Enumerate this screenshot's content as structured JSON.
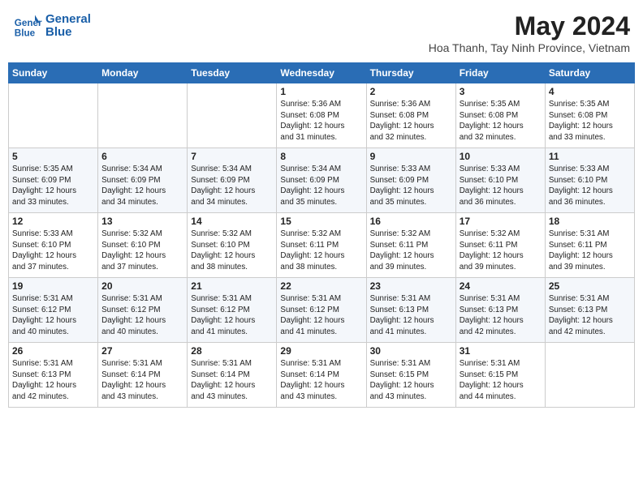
{
  "header": {
    "logo_line1": "General",
    "logo_line2": "Blue",
    "title": "May 2024",
    "subtitle": "Hoa Thanh, Tay Ninh Province, Vietnam"
  },
  "weekdays": [
    "Sunday",
    "Monday",
    "Tuesday",
    "Wednesday",
    "Thursday",
    "Friday",
    "Saturday"
  ],
  "weeks": [
    [
      {
        "day": "",
        "info": ""
      },
      {
        "day": "",
        "info": ""
      },
      {
        "day": "",
        "info": ""
      },
      {
        "day": "1",
        "info": "Sunrise: 5:36 AM\nSunset: 6:08 PM\nDaylight: 12 hours\nand 31 minutes."
      },
      {
        "day": "2",
        "info": "Sunrise: 5:36 AM\nSunset: 6:08 PM\nDaylight: 12 hours\nand 32 minutes."
      },
      {
        "day": "3",
        "info": "Sunrise: 5:35 AM\nSunset: 6:08 PM\nDaylight: 12 hours\nand 32 minutes."
      },
      {
        "day": "4",
        "info": "Sunrise: 5:35 AM\nSunset: 6:08 PM\nDaylight: 12 hours\nand 33 minutes."
      }
    ],
    [
      {
        "day": "5",
        "info": "Sunrise: 5:35 AM\nSunset: 6:09 PM\nDaylight: 12 hours\nand 33 minutes."
      },
      {
        "day": "6",
        "info": "Sunrise: 5:34 AM\nSunset: 6:09 PM\nDaylight: 12 hours\nand 34 minutes."
      },
      {
        "day": "7",
        "info": "Sunrise: 5:34 AM\nSunset: 6:09 PM\nDaylight: 12 hours\nand 34 minutes."
      },
      {
        "day": "8",
        "info": "Sunrise: 5:34 AM\nSunset: 6:09 PM\nDaylight: 12 hours\nand 35 minutes."
      },
      {
        "day": "9",
        "info": "Sunrise: 5:33 AM\nSunset: 6:09 PM\nDaylight: 12 hours\nand 35 minutes."
      },
      {
        "day": "10",
        "info": "Sunrise: 5:33 AM\nSunset: 6:10 PM\nDaylight: 12 hours\nand 36 minutes."
      },
      {
        "day": "11",
        "info": "Sunrise: 5:33 AM\nSunset: 6:10 PM\nDaylight: 12 hours\nand 36 minutes."
      }
    ],
    [
      {
        "day": "12",
        "info": "Sunrise: 5:33 AM\nSunset: 6:10 PM\nDaylight: 12 hours\nand 37 minutes."
      },
      {
        "day": "13",
        "info": "Sunrise: 5:32 AM\nSunset: 6:10 PM\nDaylight: 12 hours\nand 37 minutes."
      },
      {
        "day": "14",
        "info": "Sunrise: 5:32 AM\nSunset: 6:10 PM\nDaylight: 12 hours\nand 38 minutes."
      },
      {
        "day": "15",
        "info": "Sunrise: 5:32 AM\nSunset: 6:11 PM\nDaylight: 12 hours\nand 38 minutes."
      },
      {
        "day": "16",
        "info": "Sunrise: 5:32 AM\nSunset: 6:11 PM\nDaylight: 12 hours\nand 39 minutes."
      },
      {
        "day": "17",
        "info": "Sunrise: 5:32 AM\nSunset: 6:11 PM\nDaylight: 12 hours\nand 39 minutes."
      },
      {
        "day": "18",
        "info": "Sunrise: 5:31 AM\nSunset: 6:11 PM\nDaylight: 12 hours\nand 39 minutes."
      }
    ],
    [
      {
        "day": "19",
        "info": "Sunrise: 5:31 AM\nSunset: 6:12 PM\nDaylight: 12 hours\nand 40 minutes."
      },
      {
        "day": "20",
        "info": "Sunrise: 5:31 AM\nSunset: 6:12 PM\nDaylight: 12 hours\nand 40 minutes."
      },
      {
        "day": "21",
        "info": "Sunrise: 5:31 AM\nSunset: 6:12 PM\nDaylight: 12 hours\nand 41 minutes."
      },
      {
        "day": "22",
        "info": "Sunrise: 5:31 AM\nSunset: 6:12 PM\nDaylight: 12 hours\nand 41 minutes."
      },
      {
        "day": "23",
        "info": "Sunrise: 5:31 AM\nSunset: 6:13 PM\nDaylight: 12 hours\nand 41 minutes."
      },
      {
        "day": "24",
        "info": "Sunrise: 5:31 AM\nSunset: 6:13 PM\nDaylight: 12 hours\nand 42 minutes."
      },
      {
        "day": "25",
        "info": "Sunrise: 5:31 AM\nSunset: 6:13 PM\nDaylight: 12 hours\nand 42 minutes."
      }
    ],
    [
      {
        "day": "26",
        "info": "Sunrise: 5:31 AM\nSunset: 6:13 PM\nDaylight: 12 hours\nand 42 minutes."
      },
      {
        "day": "27",
        "info": "Sunrise: 5:31 AM\nSunset: 6:14 PM\nDaylight: 12 hours\nand 43 minutes."
      },
      {
        "day": "28",
        "info": "Sunrise: 5:31 AM\nSunset: 6:14 PM\nDaylight: 12 hours\nand 43 minutes."
      },
      {
        "day": "29",
        "info": "Sunrise: 5:31 AM\nSunset: 6:14 PM\nDaylight: 12 hours\nand 43 minutes."
      },
      {
        "day": "30",
        "info": "Sunrise: 5:31 AM\nSunset: 6:15 PM\nDaylight: 12 hours\nand 43 minutes."
      },
      {
        "day": "31",
        "info": "Sunrise: 5:31 AM\nSunset: 6:15 PM\nDaylight: 12 hours\nand 44 minutes."
      },
      {
        "day": "",
        "info": ""
      }
    ]
  ]
}
